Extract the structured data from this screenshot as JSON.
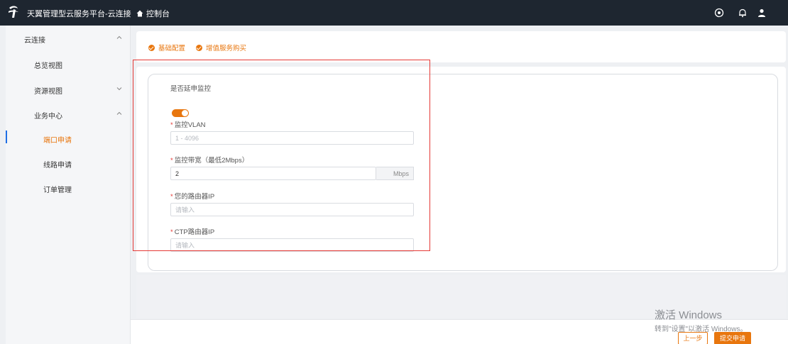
{
  "header": {
    "app_title": "天翼管理型云服务平台-云连接",
    "console_label": "控制台",
    "icons": [
      "telecom-logo-icon",
      "home-icon",
      "globe-icon",
      "bell-icon",
      "user-icon"
    ]
  },
  "sidebar": {
    "items": [
      {
        "label": "云连接",
        "expanded": true
      },
      {
        "label": "总览视图"
      },
      {
        "label": "资源视图",
        "expanded": false
      },
      {
        "label": "业务中心",
        "expanded": true
      },
      {
        "label": "端口申请",
        "active": true
      },
      {
        "label": "线路申请"
      },
      {
        "label": "订单管理"
      }
    ]
  },
  "steps": [
    {
      "label": "基础配置",
      "done": true
    },
    {
      "label": "增值服务购买",
      "done": true
    }
  ],
  "form": {
    "extend_monitor": {
      "label": "是否延申监控",
      "value": true
    },
    "vlan": {
      "label": "监控VLAN",
      "placeholder": "1 - 4096"
    },
    "bandwidth": {
      "label": "监控带宽（最低2Mbps）",
      "value": "2",
      "unit": "Mbps"
    },
    "router_ip": {
      "label": "您的路由器IP",
      "placeholder": "请输入"
    },
    "ctp_ip": {
      "label": "CTP路由器IP",
      "placeholder": "请输入"
    }
  },
  "footer": {
    "prev_label": "上一步",
    "submit_label": "提交申请"
  },
  "activation": {
    "title": "激活 Windows",
    "subtitle": "转到\"设置\"以激活 Windows。"
  },
  "colors": {
    "accent": "#e8760e",
    "topbar": "#1e2630",
    "highlight_box": "#e53935",
    "active_indicator": "#1f6fe5"
  }
}
